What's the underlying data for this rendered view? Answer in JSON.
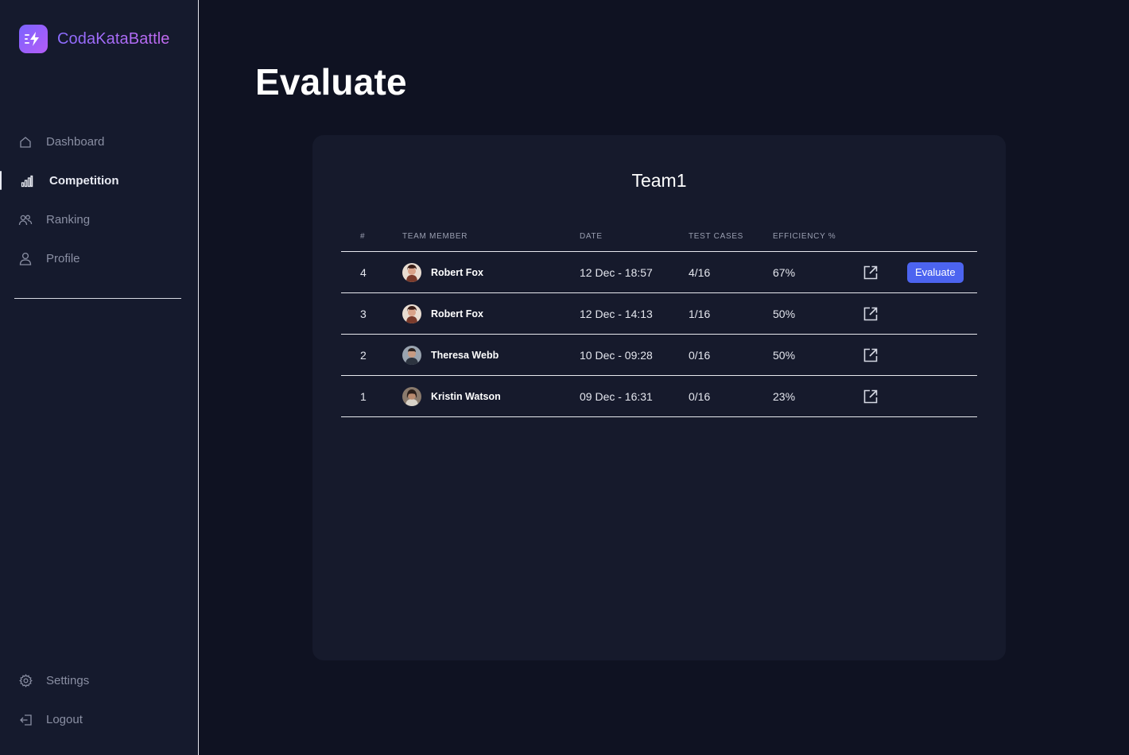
{
  "brand": {
    "name": "CodaKataBattle"
  },
  "sidebar": {
    "items": [
      {
        "label": "Dashboard",
        "icon": "home-icon",
        "active": false
      },
      {
        "label": "Competition",
        "icon": "bar-chart-icon",
        "active": true
      },
      {
        "label": "Ranking",
        "icon": "users-icon",
        "active": false
      },
      {
        "label": "Profile",
        "icon": "user-icon",
        "active": false
      }
    ],
    "bottom_items": [
      {
        "label": "Settings",
        "icon": "gear-icon"
      },
      {
        "label": "Logout",
        "icon": "logout-icon"
      }
    ]
  },
  "page": {
    "title": "Evaluate"
  },
  "team": {
    "name": "Team1",
    "columns": [
      "#",
      "Team Member",
      "Date",
      "Test Cases",
      "Efficiency %"
    ],
    "rows": [
      {
        "num": "4",
        "member": "Robert Fox",
        "date": "12 Dec - 18:57",
        "tests": "4/16",
        "efficiency": "67%",
        "action": "Evaluate"
      },
      {
        "num": "3",
        "member": "Robert Fox",
        "date": "12 Dec - 14:13",
        "tests": "1/16",
        "efficiency": "50%",
        "action": ""
      },
      {
        "num": "2",
        "member": "Theresa Webb",
        "date": "10 Dec - 09:28",
        "tests": "0/16",
        "efficiency": "50%",
        "action": ""
      },
      {
        "num": "1",
        "member": "Kristin Watson",
        "date": "09 Dec - 16:31",
        "tests": "0/16",
        "efficiency": "23%",
        "action": ""
      }
    ]
  },
  "colors": {
    "background": "#0f1222",
    "sidebar": "#151a2d",
    "card": "#161a2c",
    "accent": "#4c64f0",
    "brand_gradient_start": "#8b6cff",
    "brand_gradient_end": "#c36bf0"
  }
}
